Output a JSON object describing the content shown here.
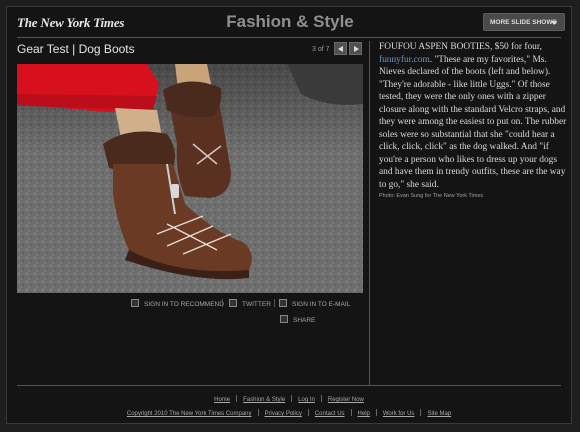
{
  "header": {
    "logo": "The New York Times",
    "section": "Fashion & Style",
    "more_button": "MORE SLIDE SHOWS"
  },
  "gallery": {
    "title": "Gear Test | Dog Boots",
    "counter": "3 of 7"
  },
  "share": {
    "recommend": "SIGN IN TO RECOMMEND",
    "twitter": "TWITTER",
    "email": "SIGN IN TO E-MAIL",
    "share": "SHARE"
  },
  "caption": {
    "text_1": "FOUFOU ASPEN BOOTIES, $50 for four, ",
    "link": "funnyfur.com",
    "text_2": ". \"These are my favorites,\" Ms. Nieves declared of the boots (left and below). \"They're adorable - like little Uggs.\" Of those tested, they were the only ones with a zipper closure along with the standard Velcro straps, and they were among the easiest to put on. The rubber soles were so substantial that she \"could hear a click, click, click\" as the dog walked. And \"if you're a person who likes to dress up your dogs and have them in trendy outfits, these are the way to go,\" she said.",
    "credit": "Photo: Evan Sung for The New York Times"
  },
  "footer": {
    "row1": [
      "Home",
      "Fashion & Style",
      "Log In",
      "Register Now"
    ],
    "copyright": "Copyright 2010 The New York Times Company",
    "row2": [
      "Privacy Policy",
      "Contact Us",
      "Help",
      "Work for Us",
      "Site Map"
    ]
  },
  "colors": {
    "background": "#141414",
    "link": "#6d95c8",
    "accent_red": "#d8101e"
  }
}
